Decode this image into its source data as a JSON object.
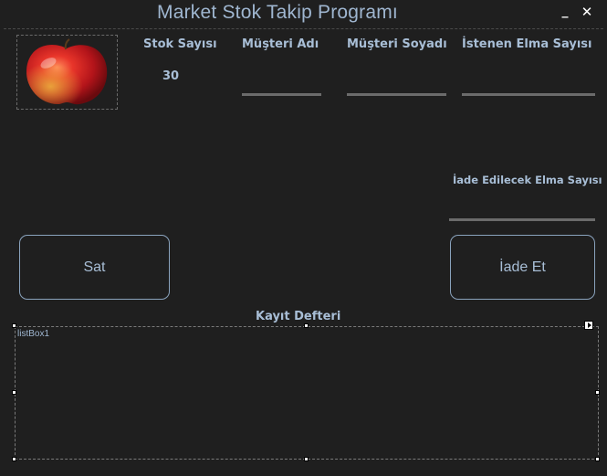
{
  "window": {
    "title": "Market Stok Takip Programı",
    "minimize_glyph": "_",
    "close_glyph": "✕"
  },
  "product": {
    "image_icon": "apple-icon"
  },
  "stock": {
    "label": "Stok Sayısı",
    "value": "30"
  },
  "customer": {
    "first_name_label": "Müşteri Adı",
    "first_name_value": "",
    "last_name_label": "Müşteri Soyadı",
    "last_name_value": "",
    "requested_label": "İstenen Elma Sayısı",
    "requested_value": ""
  },
  "returns": {
    "label": "İade Edilecek Elma Sayısı",
    "value": ""
  },
  "buttons": {
    "sell": "Sat",
    "return": "İade Et"
  },
  "log": {
    "label": "Kayıt Defteri",
    "listbox_name": "listBox1",
    "items": []
  },
  "colors": {
    "background": "#1f1f1f",
    "accent": "#a8bed6",
    "underline": "#6b6b6b"
  }
}
